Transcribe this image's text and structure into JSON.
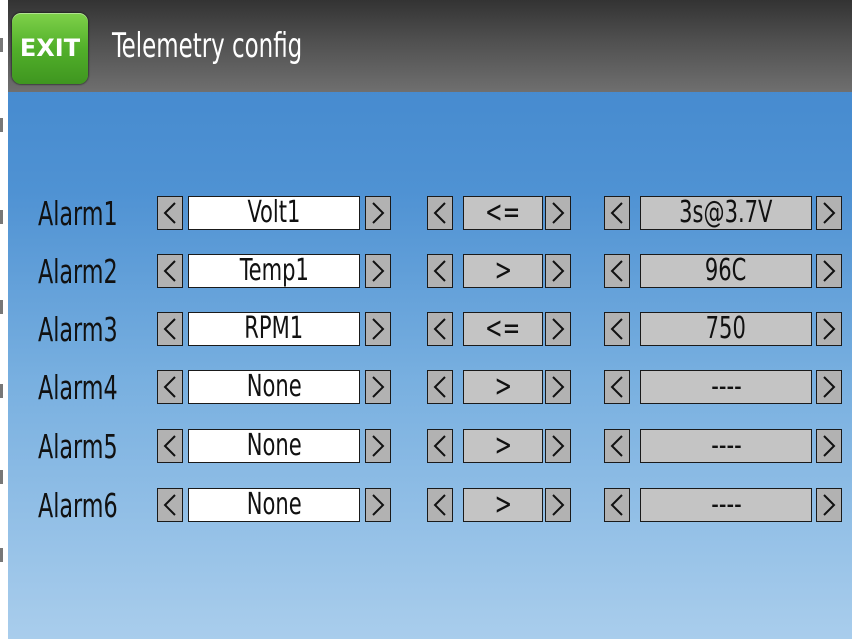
{
  "header": {
    "exit_label": "EXIT",
    "title": "Telemetry config"
  },
  "alarms": [
    {
      "label": "Alarm1",
      "source": "Volt1",
      "operator": "<=",
      "value": "3s@3.7V"
    },
    {
      "label": "Alarm2",
      "source": "Temp1",
      "operator": ">",
      "value": "96C"
    },
    {
      "label": "Alarm3",
      "source": "RPM1",
      "operator": "<=",
      "value": "750"
    },
    {
      "label": "Alarm4",
      "source": "None",
      "operator": ">",
      "value": "----"
    },
    {
      "label": "Alarm5",
      "source": "None",
      "operator": ">",
      "value": "----"
    },
    {
      "label": "Alarm6",
      "source": "None",
      "operator": ">",
      "value": "----"
    }
  ],
  "icons": {
    "exit": "exit-button",
    "prev": "chevron-left-icon",
    "next": "chevron-right-icon"
  },
  "colors": {
    "exit_button": "#52b02a",
    "titlebar": "#444444",
    "background_top": "#3f85cc",
    "background_bottom": "#a9cdec",
    "arrow_button": "#b2b2b2",
    "source_field": "#ffffff",
    "value_field": "#c4c4c4"
  }
}
